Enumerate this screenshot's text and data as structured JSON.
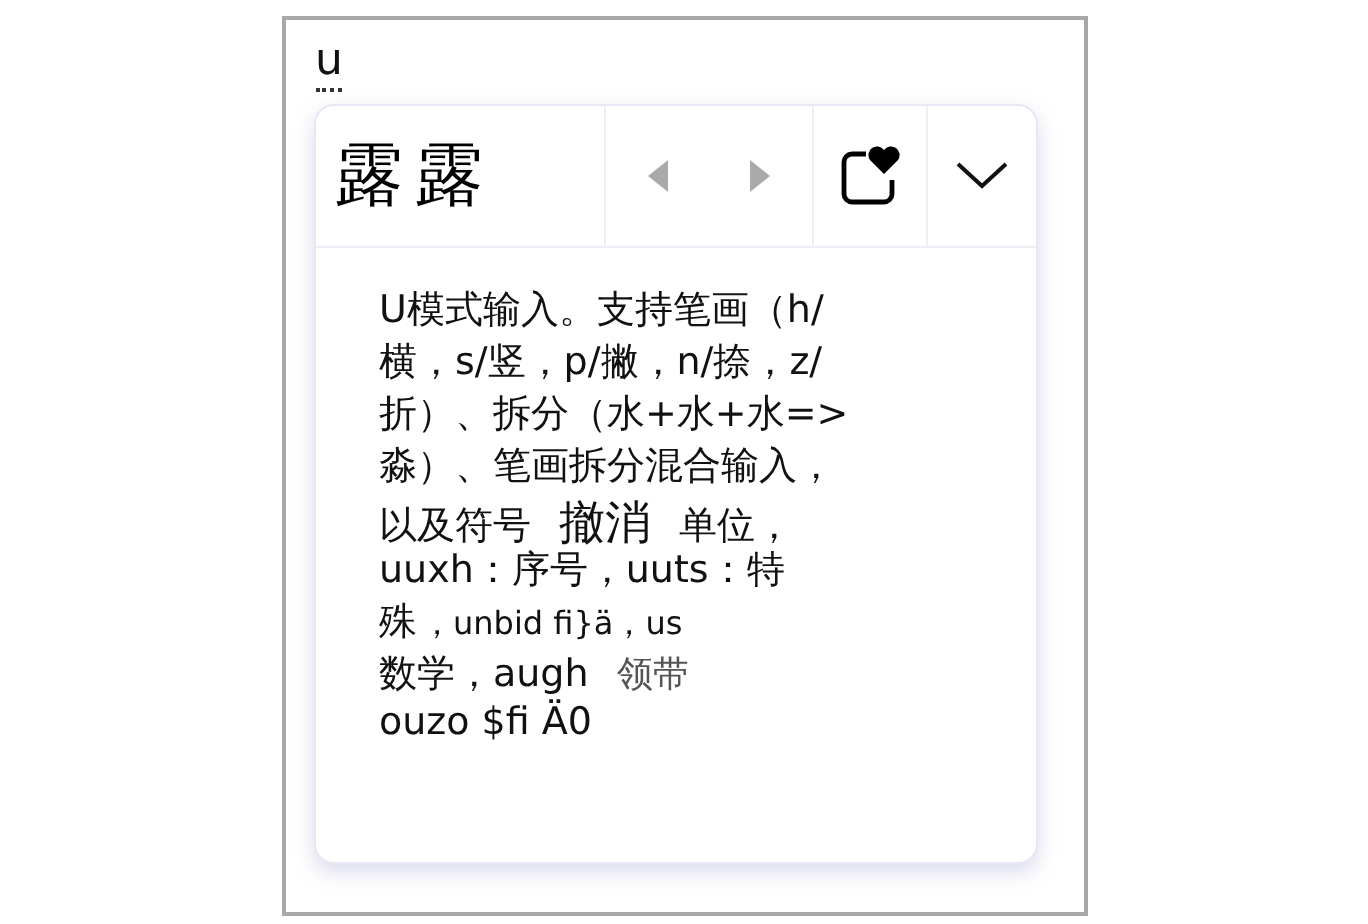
{
  "composition": "u",
  "candidates": [
    "露",
    "露"
  ],
  "paging": {
    "prev_disabled": true,
    "next_disabled": true
  },
  "description": [
    [
      {
        "kind": "normal",
        "text": "U模式输入。支持笔画（h/"
      }
    ],
    [
      {
        "kind": "normal",
        "text": "横，s/竖，p/撇，n/捺，z/"
      }
    ],
    [
      {
        "kind": "normal",
        "text": "折）、拆分（水+水+水=>"
      }
    ],
    [
      {
        "kind": "normal",
        "text": "淼）、笔画拆分混合输入，"
      }
    ],
    [
      {
        "kind": "normal",
        "text": "以及符号"
      },
      {
        "kind": "large",
        "text": "撤消"
      },
      {
        "kind": "normal",
        "text": "单位，"
      }
    ],
    [
      {
        "kind": "normal",
        "text": "uuxh：序号，uuts：特"
      }
    ],
    [
      {
        "kind": "normal",
        "text": "殊"
      },
      {
        "kind": "small",
        "text": "，unbid fi}ä，us"
      }
    ],
    [
      {
        "kind": "normal",
        "text": "数学，augh"
      },
      {
        "kind": "light",
        "text": "领带"
      }
    ],
    [
      {
        "kind": "normal",
        "text": "ouzo $fi Ä0"
      }
    ]
  ]
}
